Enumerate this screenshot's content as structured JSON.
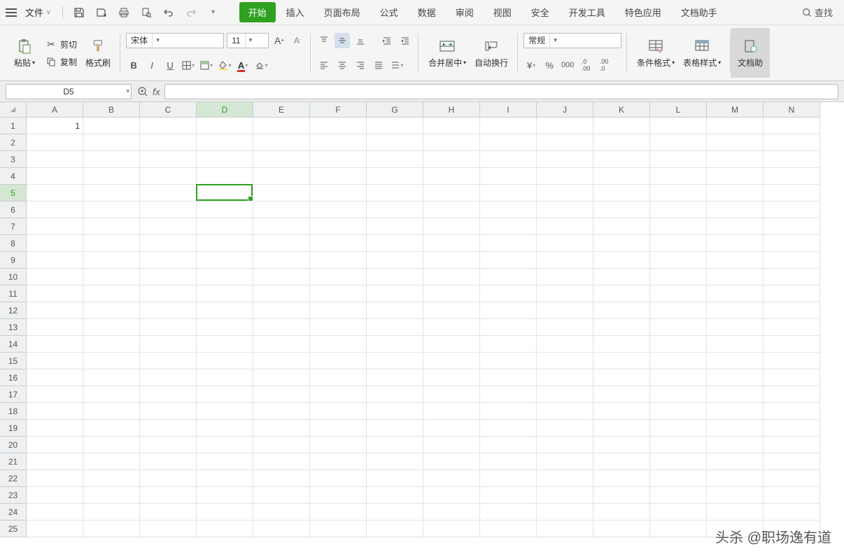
{
  "topbar": {
    "file_label": "文件",
    "find_label": "查找"
  },
  "tabs": [
    "开始",
    "插入",
    "页面布局",
    "公式",
    "数据",
    "审阅",
    "视图",
    "安全",
    "开发工具",
    "特色应用",
    "文档助手"
  ],
  "active_tab": 0,
  "ribbon": {
    "paste": "粘贴",
    "cut": "剪切",
    "copy": "复制",
    "format_painter": "格式刷",
    "font_name": "宋体",
    "font_size": "11",
    "merge_center": "合并居中",
    "auto_wrap": "自动换行",
    "number_format": "常规",
    "cond_format": "条件格式",
    "table_style": "表格样式",
    "doc_assist": "文档助"
  },
  "formula_bar": {
    "cell_ref": "D5",
    "formula": ""
  },
  "columns": [
    "A",
    "B",
    "C",
    "D",
    "E",
    "F",
    "G",
    "H",
    "I",
    "J",
    "K",
    "L",
    "M",
    "N"
  ],
  "rows": [
    1,
    2,
    3,
    4,
    5,
    6,
    7,
    8,
    9,
    10,
    11,
    12,
    13,
    14,
    15,
    16,
    17,
    18,
    19,
    20,
    21,
    22,
    23,
    24,
    25
  ],
  "active_col": 3,
  "active_row": 4,
  "cell_data": {
    "A1": "1"
  },
  "watermark": "头杀 @职场逸有道"
}
